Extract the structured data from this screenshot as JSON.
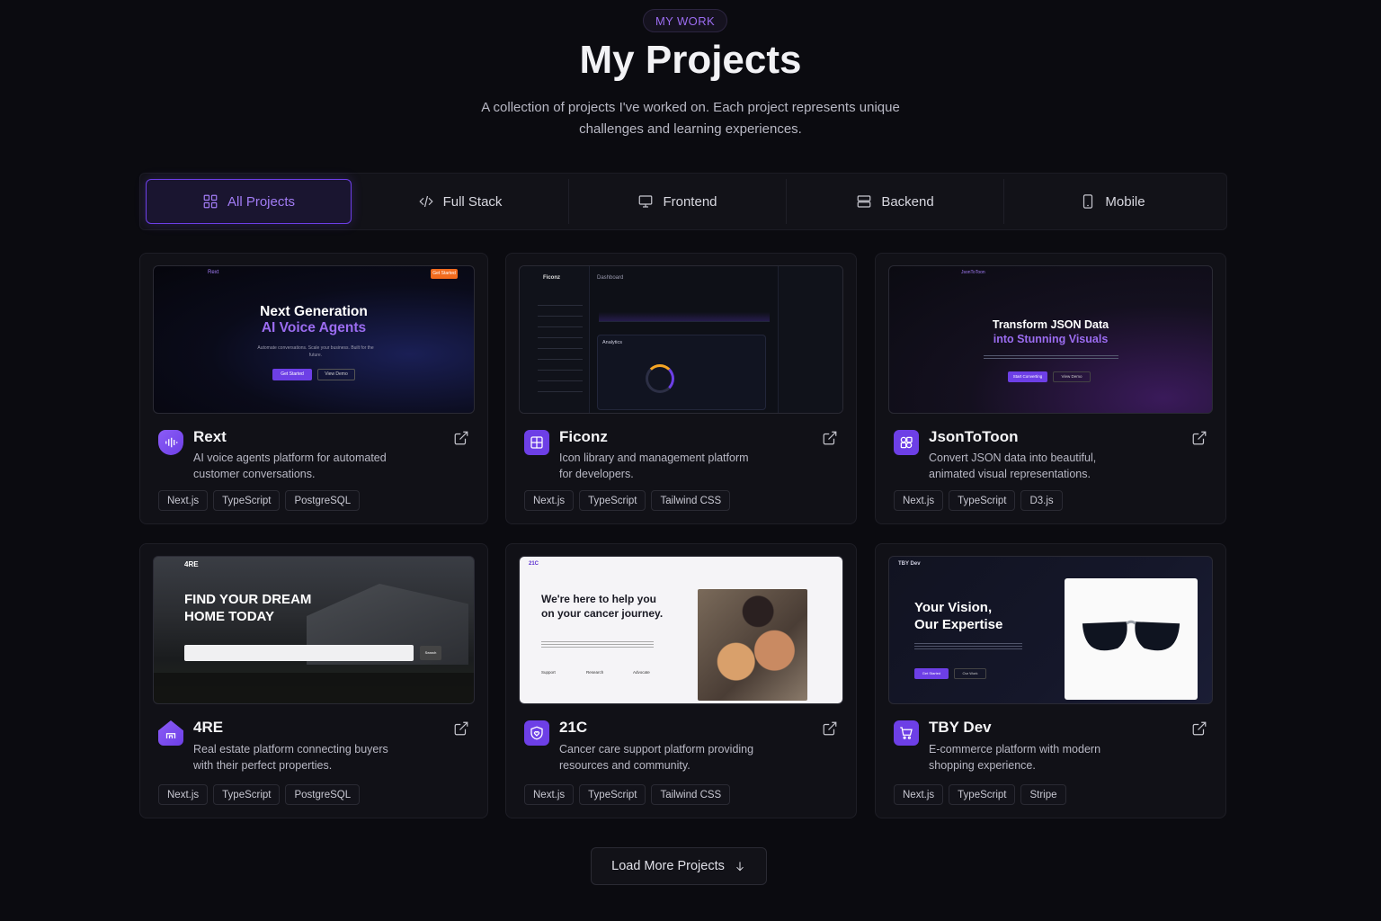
{
  "header": {
    "eyebrow": "MY WORK",
    "title": "My Projects",
    "subtitle": "A collection of projects I've worked on. Each project represents unique challenges and learning experiences."
  },
  "tabs": [
    {
      "label": "All Projects",
      "icon": "grid-icon",
      "active": true
    },
    {
      "label": "Full Stack",
      "icon": "code-icon",
      "active": false
    },
    {
      "label": "Frontend",
      "icon": "monitor-icon",
      "active": false
    },
    {
      "label": "Backend",
      "icon": "server-icon",
      "active": false
    },
    {
      "label": "Mobile",
      "icon": "smartphone-icon",
      "active": false
    }
  ],
  "projects": [
    {
      "name": "Rext",
      "description": "AI voice agents platform for automated customer conversations.",
      "tags": [
        "Next.js",
        "TypeScript",
        "PostgreSQL"
      ],
      "preview": {
        "brand": "Rext",
        "headline1": "Next Generation",
        "headline2": "AI Voice Agents",
        "body": "Automate conversations. Scale your business. Built for the future.",
        "cta1": "Get Started",
        "cta2": "View Demo",
        "nav_cta": "Get Started"
      }
    },
    {
      "name": "Ficonz",
      "description": "Icon library and management platform for developers.",
      "tags": [
        "Next.js",
        "TypeScript",
        "Tailwind CSS"
      ],
      "preview": {
        "brand": "Ficonz",
        "section": "Dashboard",
        "panel": "Analytics"
      }
    },
    {
      "name": "JsonToToon",
      "description": "Convert JSON data into beautiful, animated visual representations.",
      "tags": [
        "Next.js",
        "TypeScript",
        "D3.js"
      ],
      "preview": {
        "brand": "JsonToToon",
        "headline1": "Transform JSON Data",
        "headline2": "into Stunning Visuals",
        "cta1": "Start Converting",
        "cta2": "View Demo"
      }
    },
    {
      "name": "4RE",
      "description": "Real estate platform connecting buyers with their perfect properties.",
      "tags": [
        "Next.js",
        "TypeScript",
        "PostgreSQL"
      ],
      "preview": {
        "brand": "4RE",
        "headline1": "FIND YOUR DREAM",
        "headline2": "HOME TODAY",
        "search_cta": "Search"
      }
    },
    {
      "name": "21C",
      "description": "Cancer care support platform providing resources and community.",
      "tags": [
        "Next.js",
        "TypeScript",
        "Tailwind CSS"
      ],
      "preview": {
        "brand": "21C",
        "headline": "We're here to help you on your cancer journey.",
        "features": [
          "Support",
          "Research",
          "Advocate"
        ]
      }
    },
    {
      "name": "TBY Dev",
      "description": "E-commerce platform with modern shopping experience.",
      "tags": [
        "Next.js",
        "TypeScript",
        "Stripe"
      ],
      "preview": {
        "brand": "TBY Dev",
        "headline1": "Your Vision,",
        "headline2": "Our Expertise",
        "cta1": "Get Started",
        "cta2": "Our Work"
      }
    }
  ],
  "load_more": "Load More Projects",
  "colors": {
    "accent": "#6d3fe6",
    "accent_light": "#a27cf5",
    "background": "#0b0b10",
    "card": "#111117"
  }
}
